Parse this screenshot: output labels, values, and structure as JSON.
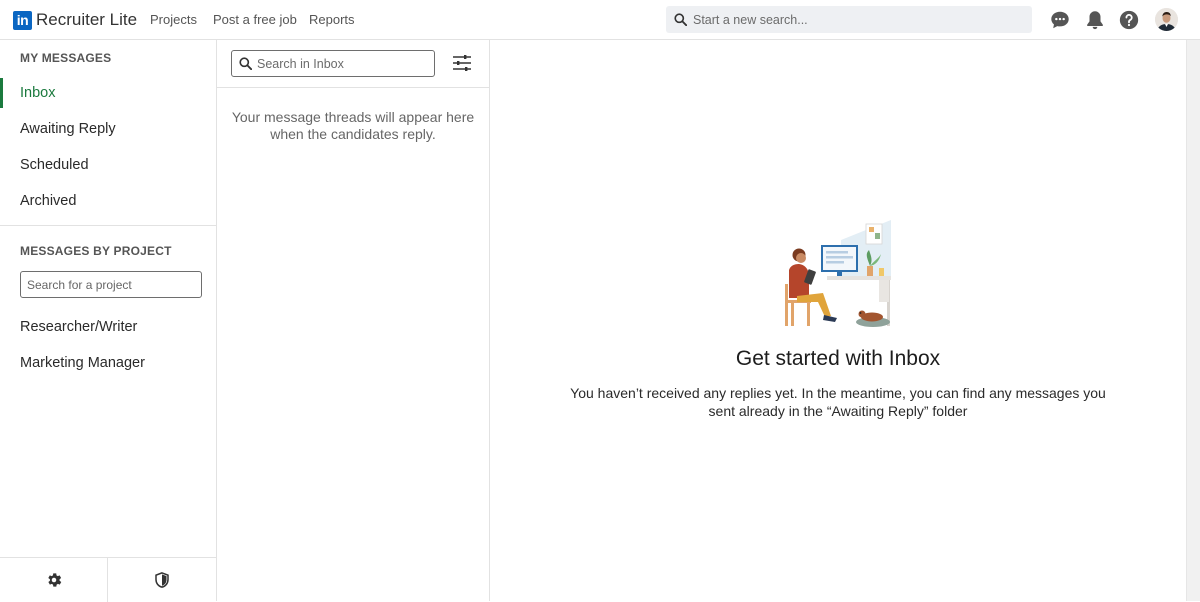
{
  "brand": {
    "logo_text": "in",
    "name": "Recruiter Lite"
  },
  "nav": {
    "links": [
      "Projects",
      "Post a free job",
      "Reports"
    ]
  },
  "top_search": {
    "placeholder": "Start a new search..."
  },
  "top_icons": [
    "messages-icon",
    "bell-icon",
    "help-icon",
    "avatar"
  ],
  "sidebar": {
    "my_messages_title": "MY MESSAGES",
    "items": [
      {
        "label": "Inbox",
        "active": true
      },
      {
        "label": "Awaiting Reply"
      },
      {
        "label": "Scheduled"
      },
      {
        "label": "Archived"
      }
    ],
    "by_project_title": "MESSAGES BY PROJECT",
    "project_search_placeholder": "Search for a project",
    "projects": [
      "Researcher/Writer",
      "Marketing Manager"
    ],
    "bottom_icons": [
      "gear-icon",
      "shield-icon"
    ]
  },
  "threads": {
    "search_placeholder": "Search in Inbox",
    "empty_text": "Your message threads will appear here when the candidates reply."
  },
  "main": {
    "title": "Get started with Inbox",
    "description": "You haven’t received any replies yet. In the meantime, you can find any messages you sent already in the “Awaiting Reply” folder"
  },
  "colors": {
    "brand_blue": "#0a66c2",
    "active_green": "#1b7a3e",
    "icon_gray": "#555555"
  }
}
